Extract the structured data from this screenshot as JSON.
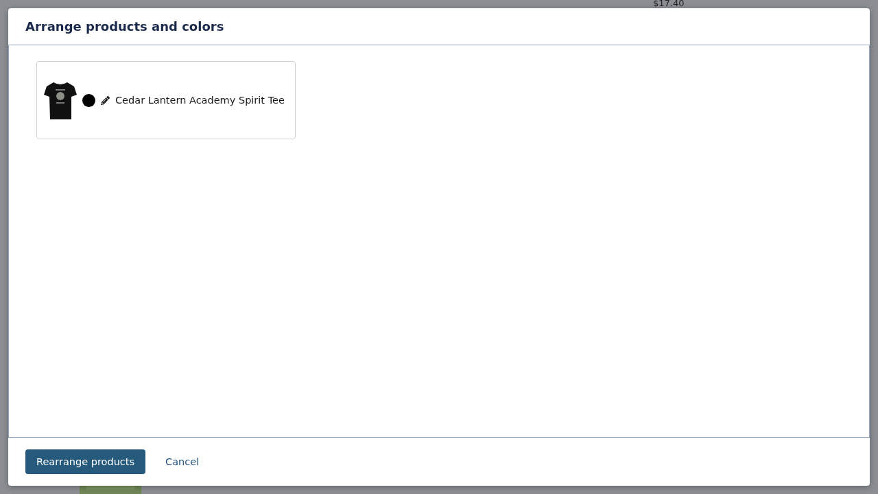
{
  "background": {
    "price": "$17.40"
  },
  "dialog": {
    "title": "Arrange products and colors",
    "products": [
      {
        "name": "Cedar Lantern Academy Spirit Tee",
        "color": "#000000"
      }
    ],
    "buttons": [
      {
        "kind": "primary",
        "label": "Rearrange products"
      },
      {
        "kind": "link",
        "label": "Cancel"
      }
    ]
  }
}
